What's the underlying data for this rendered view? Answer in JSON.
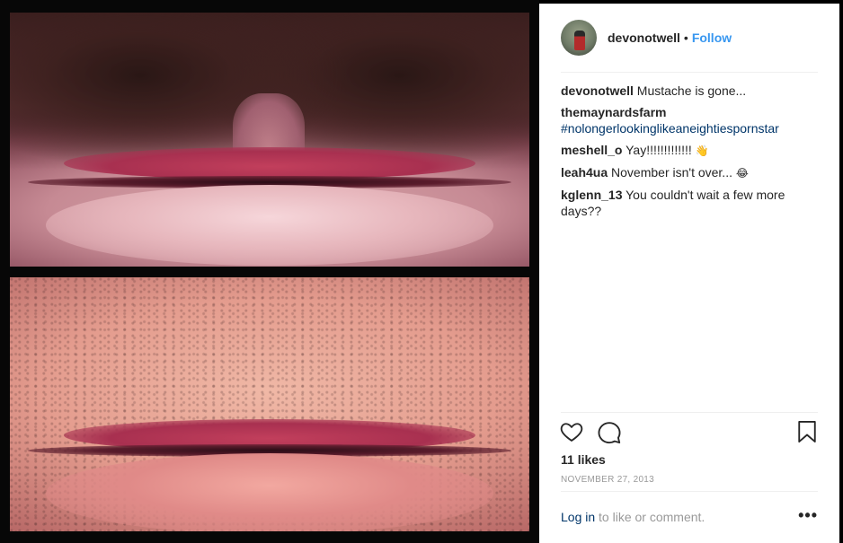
{
  "post": {
    "author": "devonotwell",
    "follow_label": "Follow",
    "separator": "•",
    "likes_text": "11 likes",
    "date": "NOVEMBER 27, 2013"
  },
  "comments": [
    {
      "user": "devonotwell",
      "text": "Mustache is gone..."
    },
    {
      "user": "themaynardsfarm",
      "text": "",
      "hashtag": "#nolongerlookinglikeaneightiespornstar"
    },
    {
      "user": "meshell_o",
      "text": "Yay!!!!!!!!!!!!! ",
      "emoji": "👋"
    },
    {
      "user": "leah4ua",
      "text": "November isn't over... ",
      "emoji": "😂"
    },
    {
      "user": "kglenn_13",
      "text": "You couldn't wait a few more days??"
    }
  ],
  "footer": {
    "login_link": "Log in",
    "login_suffix": " to like or comment.",
    "more_label": "•••"
  },
  "icons": {
    "heart": "heart-icon",
    "comment": "comment-icon",
    "bookmark": "bookmark-icon"
  }
}
